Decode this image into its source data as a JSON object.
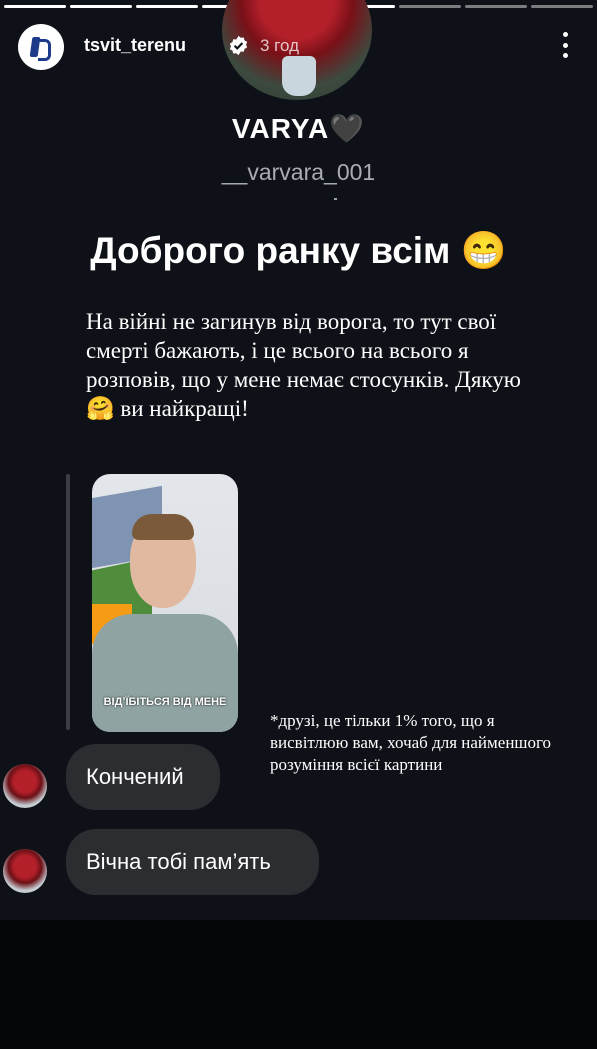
{
  "account": {
    "name": "tsvit_terenu",
    "time": "3 год"
  },
  "profile": {
    "display_name": "VARYA",
    "emoji": "🖤",
    "handle": "__varvara_001"
  },
  "greeting": {
    "text": "Доброго ранку всім",
    "emoji": "😁"
  },
  "message": {
    "part1": "На війні не загинув від ворога, то тут свої смерті бажають, і це всього на всього я розповів, що у мене немає стосунків. Дякую",
    "emoji": "🤗",
    "part2": "ви найкращі!"
  },
  "video": {
    "caption": "ВІДʼЇБІТЬСЯ ВІД МЕНЕ"
  },
  "note": "*друзі, це тільки 1% того, що я висвітлюю вам, хочаб для найменшого розуміння всієї картини",
  "comments": [
    {
      "text": "Кончений"
    },
    {
      "text": "Вічна тобі пам’ять"
    }
  ]
}
